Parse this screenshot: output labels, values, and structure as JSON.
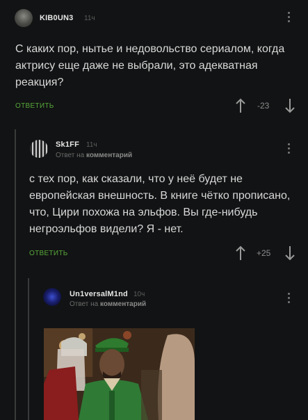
{
  "comments": [
    {
      "username": "KIB0UN3",
      "time": "11ч",
      "text": [
        "С каких пор, нытье и недовольство сериалом, когда",
        "актрису еще даже не выбрали, это адекватная",
        "реакция?"
      ],
      "reply_label": "ОТВЕТИТЬ",
      "score": "-23"
    },
    {
      "username": "Sk1FF",
      "time": "11ч",
      "reply_to": "Ответ на",
      "reply_to_target": "комментарий",
      "text": [
        "с тех пор, как сказали, что у неё будет не",
        "европейская внешность. В книге чётко прописано,",
        "что, Цири похожа на эльфов. Вы где-нибудь",
        "негроэльфов видели? Я - нет."
      ],
      "reply_label": "ОТВЕТИТЬ",
      "score": "+25"
    },
    {
      "username": "Un1versalM1nd",
      "time": "10ч",
      "reply_to": "Ответ на",
      "reply_to_target": "комментарий"
    }
  ],
  "icons": {
    "upvote": "arrow-up-icon",
    "downvote": "arrow-down-icon",
    "menu": "kebab-menu-icon"
  },
  "colors": {
    "background": "#121314",
    "accent_green": "#57a83a",
    "thread_line": "#3a3a3a"
  }
}
